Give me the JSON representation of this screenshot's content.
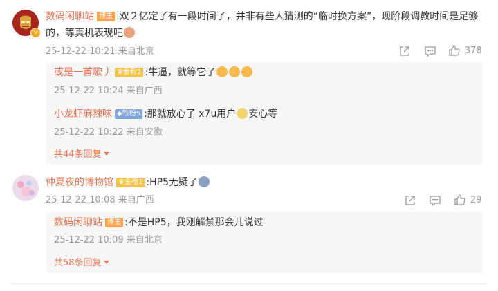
{
  "comments": [
    {
      "author": "数码闲聊站",
      "badge": "博主",
      "text": "双２亿定了有一段时间了，并非有些人猜测的“临时换方案”，现阶段调教时间是足够的，等真机表现吧",
      "time": "25-12-22 10:21",
      "location": "来自北京",
      "likes": "378",
      "replies": [
        {
          "author": "或是一首歌丿",
          "badge": "金粉2",
          "text": "牛逼，就等它了",
          "time": "25-12-22 10:24",
          "location": "来自广西"
        },
        {
          "author": "小龙虾麻辣味",
          "badge": "铁粉5",
          "text_before": "那就放心了 x7u用户",
          "text_after": "安心等",
          "time": "25-12-22 10:22",
          "location": "来自安徽"
        }
      ],
      "more_replies": "共44条回复"
    },
    {
      "author": "仲夏夜的博物馆",
      "badge": "金粉1",
      "text": "HP5无疑了",
      "time": "25-12-22 10:08",
      "location": "来自广西",
      "likes": "29",
      "replies": [
        {
          "author": "数码闲聊站",
          "badge": "博主",
          "text": "不是HP5，我刚解禁那会儿说过",
          "time": "25-12-22 10:09",
          "location": "来自北京"
        }
      ],
      "more_replies": "共58条回复"
    }
  ],
  "icons": {
    "share": "share-icon",
    "comment": "comment-icon",
    "like": "thumbs-up-icon"
  },
  "colors": {
    "author_name": "#eb7350",
    "meta_gray": "#999999",
    "host_badge": "#ffa54f",
    "gold_badge": "#f3c443",
    "iron_badge": "#7ea6dd"
  }
}
